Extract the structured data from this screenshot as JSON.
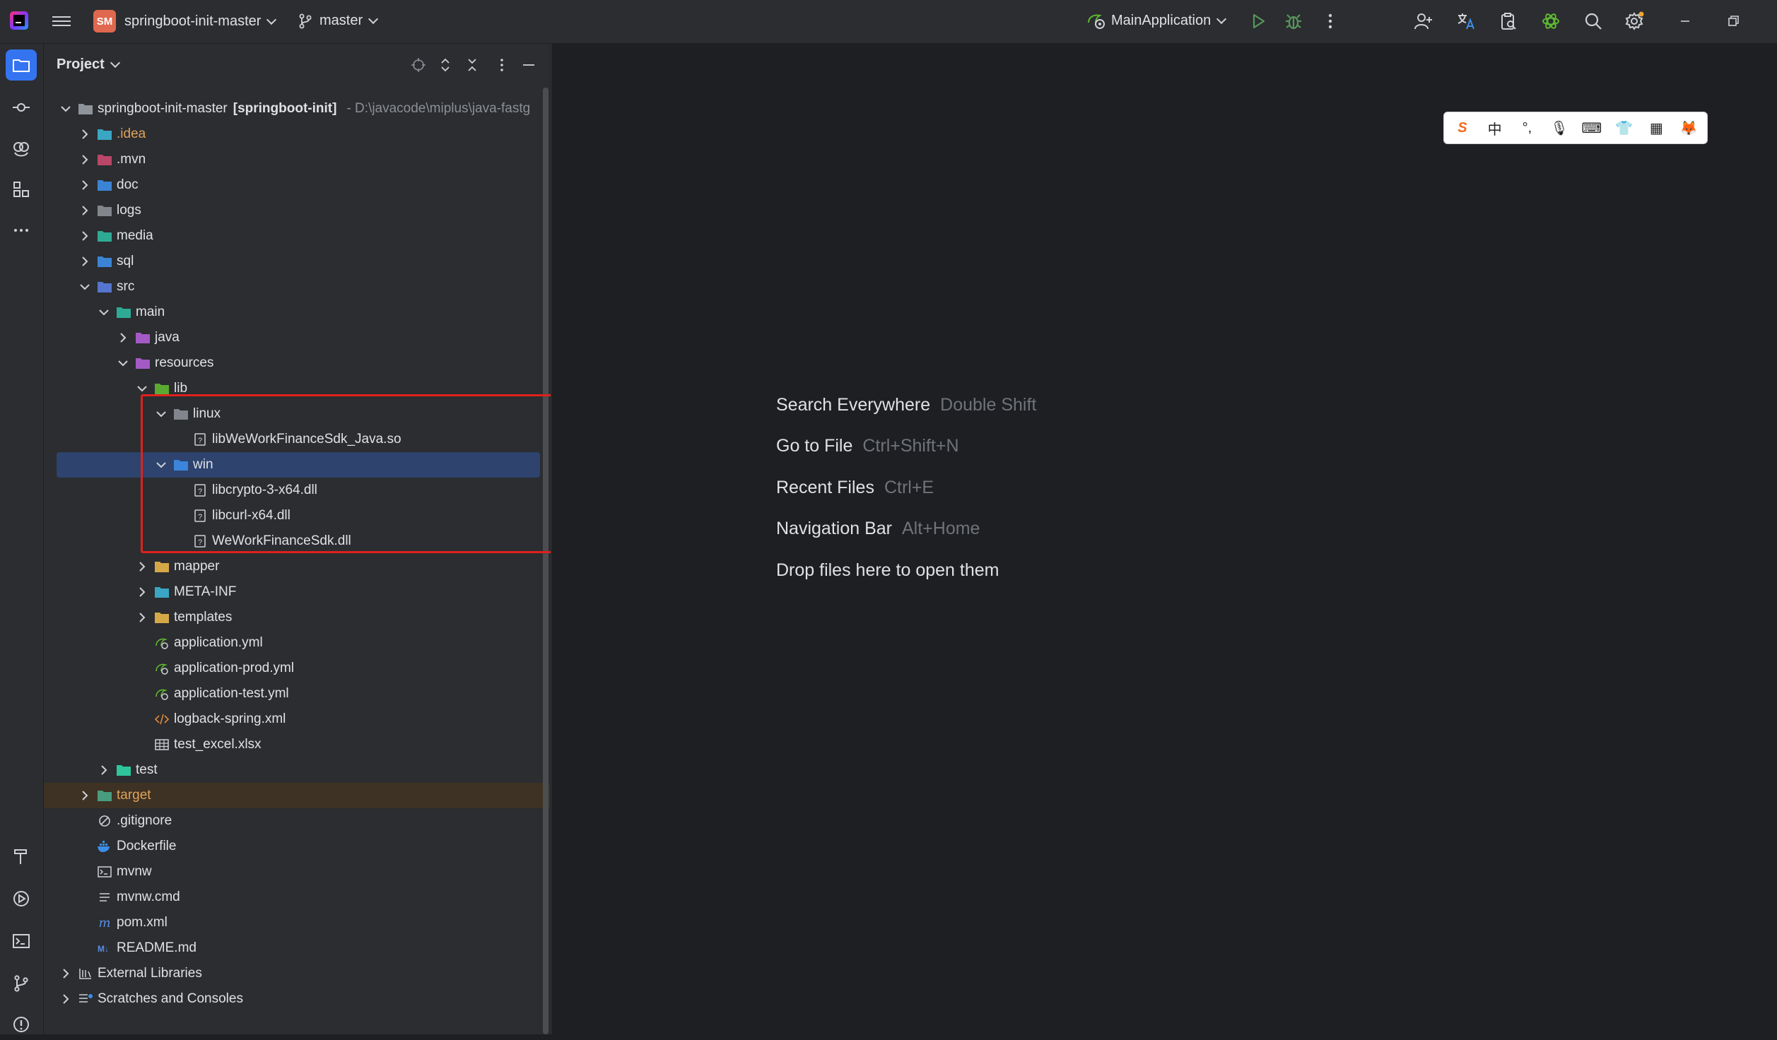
{
  "titlebar": {
    "project_badge": "SM",
    "project_name": "springboot-init-master",
    "branch": "master",
    "run_config": "MainApplication"
  },
  "project_panel": {
    "title": "Project",
    "tree": [
      {
        "label": "springboot-init-master",
        "module": "[springboot-init]",
        "path": "- D:\\javacode\\miplus\\java-fastg",
        "depth": 0,
        "expanded": true,
        "icon": "module-folder-icon"
      },
      {
        "label": ".idea",
        "depth": 1,
        "expanded": false,
        "icon": "idea-folder-icon",
        "color": "orange"
      },
      {
        "label": ".mvn",
        "depth": 1,
        "expanded": false,
        "icon": "mvn-folder-icon"
      },
      {
        "label": "doc",
        "depth": 1,
        "expanded": false,
        "icon": "doc-folder-icon"
      },
      {
        "label": "logs",
        "depth": 1,
        "expanded": false,
        "icon": "folder-icon"
      },
      {
        "label": "media",
        "depth": 1,
        "expanded": false,
        "icon": "media-folder-icon"
      },
      {
        "label": "sql",
        "depth": 1,
        "expanded": false,
        "icon": "sql-folder-icon"
      },
      {
        "label": "src",
        "depth": 1,
        "expanded": true,
        "icon": "src-folder-icon"
      },
      {
        "label": "main",
        "depth": 2,
        "expanded": true,
        "icon": "main-folder-icon"
      },
      {
        "label": "java",
        "depth": 3,
        "expanded": false,
        "icon": "java-source-folder-icon"
      },
      {
        "label": "resources",
        "depth": 3,
        "expanded": true,
        "icon": "resources-folder-icon"
      },
      {
        "label": "lib",
        "depth": 4,
        "expanded": true,
        "icon": "lib-folder-icon"
      },
      {
        "label": "linux",
        "depth": 5,
        "expanded": true,
        "icon": "linux-folder-icon"
      },
      {
        "label": "libWeWorkFinanceSdk_Java.so",
        "depth": 6,
        "icon": "unknown-file-icon"
      },
      {
        "label": "win",
        "depth": 5,
        "expanded": true,
        "icon": "windows-folder-icon",
        "selected": true
      },
      {
        "label": "libcrypto-3-x64.dll",
        "depth": 6,
        "icon": "unknown-file-icon"
      },
      {
        "label": "libcurl-x64.dll",
        "depth": 6,
        "icon": "unknown-file-icon"
      },
      {
        "label": "WeWorkFinanceSdk.dll",
        "depth": 6,
        "icon": "unknown-file-icon"
      },
      {
        "label": "mapper",
        "depth": 4,
        "expanded": false,
        "icon": "yellow-folder-icon"
      },
      {
        "label": "META-INF",
        "depth": 4,
        "expanded": false,
        "icon": "meta-inf-folder-icon"
      },
      {
        "label": "templates",
        "depth": 4,
        "expanded": false,
        "icon": "yellow-folder-icon"
      },
      {
        "label": "application.yml",
        "depth": 4,
        "icon": "spring-yml-icon"
      },
      {
        "label": "application-prod.yml",
        "depth": 4,
        "icon": "spring-yml-icon"
      },
      {
        "label": "application-test.yml",
        "depth": 4,
        "icon": "spring-yml-icon"
      },
      {
        "label": "logback-spring.xml",
        "depth": 4,
        "icon": "xml-file-icon"
      },
      {
        "label": "test_excel.xlsx",
        "depth": 4,
        "icon": "table-file-icon"
      },
      {
        "label": "test",
        "depth": 2,
        "expanded": false,
        "icon": "test-folder-icon"
      },
      {
        "label": "target",
        "depth": 1,
        "expanded": false,
        "icon": "target-folder-icon",
        "color": "orange",
        "excluded": true
      },
      {
        "label": ".gitignore",
        "depth": 1,
        "icon": "gitignore-icon"
      },
      {
        "label": "Dockerfile",
        "depth": 1,
        "icon": "docker-icon"
      },
      {
        "label": "mvnw",
        "depth": 1,
        "icon": "shell-script-icon"
      },
      {
        "label": "mvnw.cmd",
        "depth": 1,
        "icon": "text-file-icon"
      },
      {
        "label": "pom.xml",
        "depth": 1,
        "icon": "maven-pom-icon"
      },
      {
        "label": "README.md",
        "depth": 1,
        "icon": "markdown-icon"
      },
      {
        "label": "External Libraries",
        "depth": 0,
        "expanded": false,
        "icon": "library-icon"
      },
      {
        "label": "Scratches and Consoles",
        "depth": 0,
        "expanded": false,
        "icon": "scratches-icon"
      }
    ]
  },
  "editor": {
    "hints": [
      {
        "action": "Search Everywhere",
        "shortcut": "Double Shift"
      },
      {
        "action": "Go to File",
        "shortcut": "Ctrl+Shift+N"
      },
      {
        "action": "Recent Files",
        "shortcut": "Ctrl+E"
      },
      {
        "action": "Navigation Bar",
        "shortcut": "Alt+Home"
      },
      {
        "action": "Drop files here to open them",
        "shortcut": ""
      }
    ],
    "ime_toolbar": {
      "mode_label": "中"
    }
  },
  "colors": {
    "accent": "#3574f0",
    "selection": "#2e436e",
    "highlight_box": "#e0201c",
    "excluded_text": "#e0a25c"
  }
}
